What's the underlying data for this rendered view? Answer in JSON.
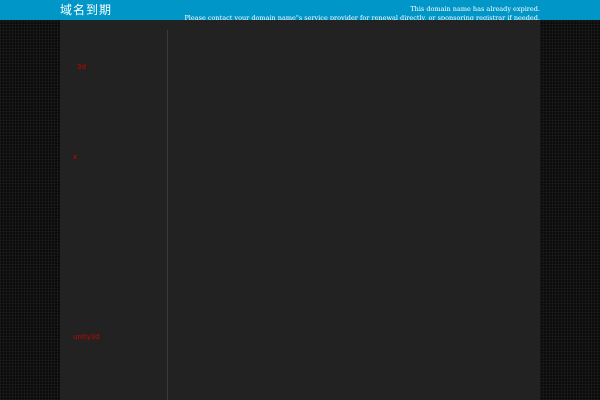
{
  "header": {
    "brand_label": "域名到期",
    "notice_line1": "This domain name has already expired.",
    "notice_line2": "Please contact your domain name\"s service provider for renewal directly, or sponsoring registrar if needed."
  },
  "sidebar": {
    "links": [
      {
        "label": "3d"
      },
      {
        "label": "x"
      },
      {
        "label": "unity3d"
      }
    ]
  },
  "colors": {
    "header_bg": "#0096c8",
    "panel_bg": "#222222",
    "link": "#cc0000",
    "page_bg": "#0c0c0c"
  }
}
